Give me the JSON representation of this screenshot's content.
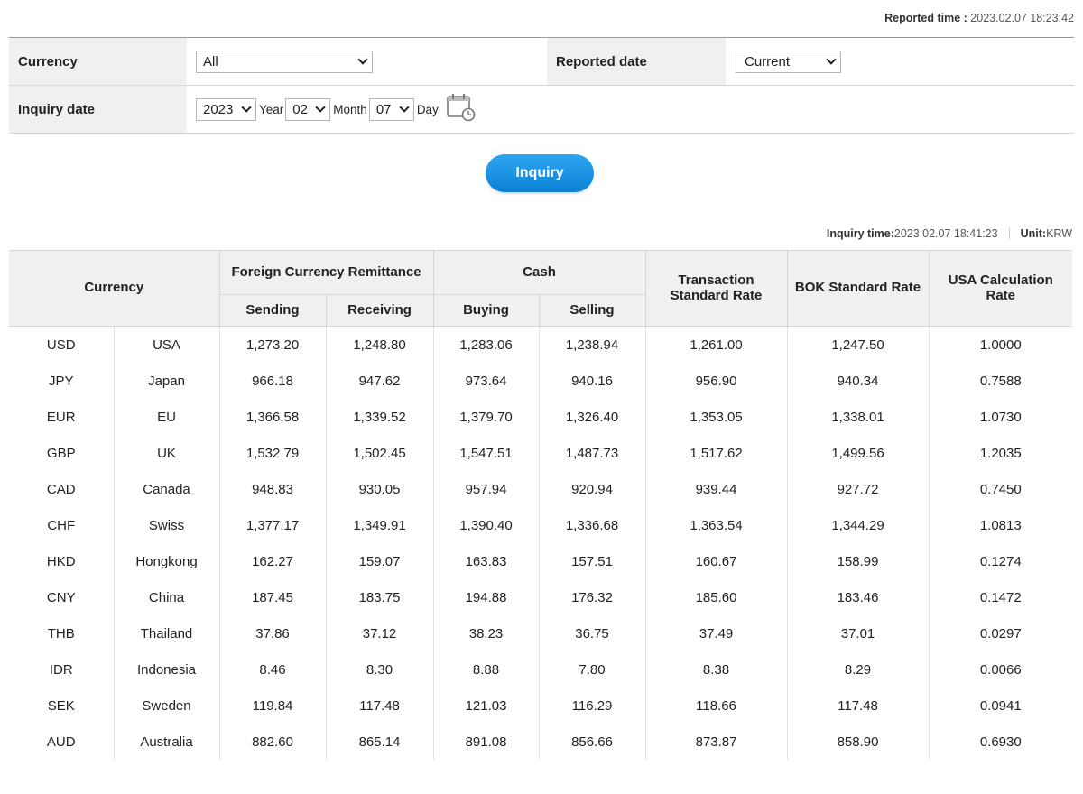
{
  "reported": {
    "label": "Reported time",
    "colon": " : ",
    "value": "2023.02.07 18:23:42"
  },
  "form": {
    "currency_label": "Currency",
    "currency_value": "All",
    "reported_date_label": "Reported date",
    "reported_date_value": "Current",
    "inquiry_date_label": "Inquiry date",
    "year_value": "2023",
    "year_unit": "Year",
    "month_value": "02",
    "month_unit": "Month",
    "day_value": "07",
    "day_unit": "Day"
  },
  "inquiry_button": "Inquiry",
  "inquiry_info": {
    "time_label": "Inquiry time",
    "colon": " : ",
    "time_value": "2023.02.07 18:41:23",
    "unit_label": "Unit",
    "unit_value": "KRW"
  },
  "table": {
    "headers": {
      "currency": "Currency",
      "remittance": "Foreign Currency Remittance",
      "cash": "Cash",
      "transaction": "Transaction Standard Rate",
      "bok": "BOK Standard Rate",
      "usa": "USA Calculation Rate",
      "sending": "Sending",
      "receiving": "Receiving",
      "buying": "Buying",
      "selling": "Selling"
    },
    "rows": [
      [
        "USD",
        "USA",
        "1,273.20",
        "1,248.80",
        "1,283.06",
        "1,238.94",
        "1,261.00",
        "1,247.50",
        "1.0000"
      ],
      [
        "JPY",
        "Japan",
        "966.18",
        "947.62",
        "973.64",
        "940.16",
        "956.90",
        "940.34",
        "0.7588"
      ],
      [
        "EUR",
        "EU",
        "1,366.58",
        "1,339.52",
        "1,379.70",
        "1,326.40",
        "1,353.05",
        "1,338.01",
        "1.0730"
      ],
      [
        "GBP",
        "UK",
        "1,532.79",
        "1,502.45",
        "1,547.51",
        "1,487.73",
        "1,517.62",
        "1,499.56",
        "1.2035"
      ],
      [
        "CAD",
        "Canada",
        "948.83",
        "930.05",
        "957.94",
        "920.94",
        "939.44",
        "927.72",
        "0.7450"
      ],
      [
        "CHF",
        "Swiss",
        "1,377.17",
        "1,349.91",
        "1,390.40",
        "1,336.68",
        "1,363.54",
        "1,344.29",
        "1.0813"
      ],
      [
        "HKD",
        "Hongkong",
        "162.27",
        "159.07",
        "163.83",
        "157.51",
        "160.67",
        "158.99",
        "0.1274"
      ],
      [
        "CNY",
        "China",
        "187.45",
        "183.75",
        "194.88",
        "176.32",
        "185.60",
        "183.46",
        "0.1472"
      ],
      [
        "THB",
        "Thailand",
        "37.86",
        "37.12",
        "38.23",
        "36.75",
        "37.49",
        "37.01",
        "0.0297"
      ],
      [
        "IDR",
        "Indonesia",
        "8.46",
        "8.30",
        "8.88",
        "7.80",
        "8.38",
        "8.29",
        "0.0066"
      ],
      [
        "SEK",
        "Sweden",
        "119.84",
        "117.48",
        "121.03",
        "116.29",
        "118.66",
        "117.48",
        "0.0941"
      ],
      [
        "AUD",
        "Australia",
        "882.60",
        "865.14",
        "891.08",
        "856.66",
        "873.87",
        "858.90",
        "0.6930"
      ]
    ]
  }
}
